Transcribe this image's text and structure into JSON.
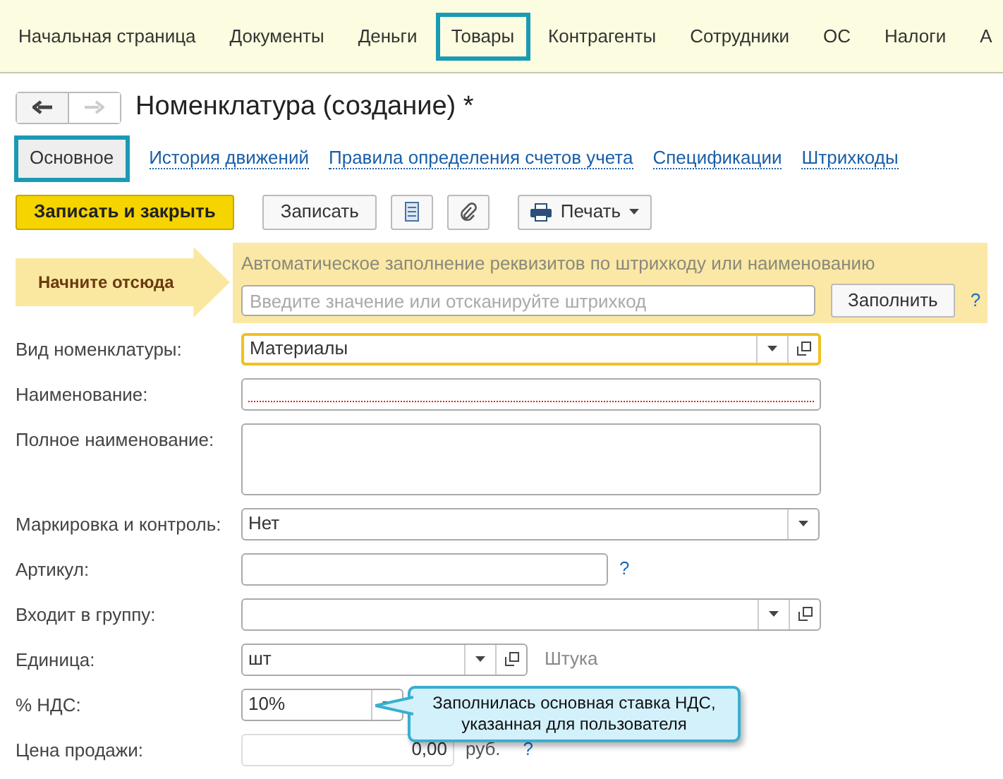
{
  "nav": [
    {
      "label": "Начальная страница",
      "selected": false
    },
    {
      "label": "Документы",
      "selected": false
    },
    {
      "label": "Деньги",
      "selected": false
    },
    {
      "label": "Товары",
      "selected": true
    },
    {
      "label": "Контрагенты",
      "selected": false
    },
    {
      "label": "Сотрудники",
      "selected": false
    },
    {
      "label": "ОС",
      "selected": false
    },
    {
      "label": "Налоги",
      "selected": false
    },
    {
      "label": "А",
      "selected": false
    }
  ],
  "title": "Номенклатура (создание) *",
  "tabs": [
    {
      "label": "Основное",
      "selected": true
    },
    {
      "label": "История движений",
      "selected": false
    },
    {
      "label": "Правила определения счетов учета",
      "selected": false
    },
    {
      "label": "Спецификации",
      "selected": false
    },
    {
      "label": "Штрихкоды",
      "selected": false
    }
  ],
  "toolbar": {
    "save_close": "Записать и закрыть",
    "save": "Записать",
    "print": "Печать"
  },
  "start_here": "Начните отсюда",
  "autofill": {
    "heading": "Автоматическое заполнение реквизитов по штрихкоду или наименованию",
    "placeholder": "Введите значение или отсканируйте штрихкод",
    "button": "Заполнить",
    "help": "?"
  },
  "fields": [
    {
      "kind": "combo",
      "label": "Вид номенклатуры:",
      "value": "Материалы",
      "focused": true
    },
    {
      "kind": "text",
      "label": "Наименование:",
      "required": true
    },
    {
      "kind": "textarea",
      "label": "Полное наименование:"
    },
    {
      "kind": "select",
      "label": "Маркировка и контроль:",
      "value": "Нет"
    },
    {
      "kind": "short",
      "label": "Артикул:",
      "help": "?"
    },
    {
      "kind": "combo",
      "label": "Входит в группу:"
    },
    {
      "kind": "unit",
      "label": "Единица:",
      "value": "шт",
      "note": "Штука"
    },
    {
      "kind": "vat",
      "label": "% НДС:",
      "value": "10%"
    },
    {
      "kind": "price",
      "label": "Цена продажи:",
      "value": "0,00",
      "note": "руб.",
      "help": "?"
    }
  ],
  "tooltip": {
    "lines": [
      "Заполнилась основная ставка НДС,",
      "указанная для пользователя"
    ]
  }
}
